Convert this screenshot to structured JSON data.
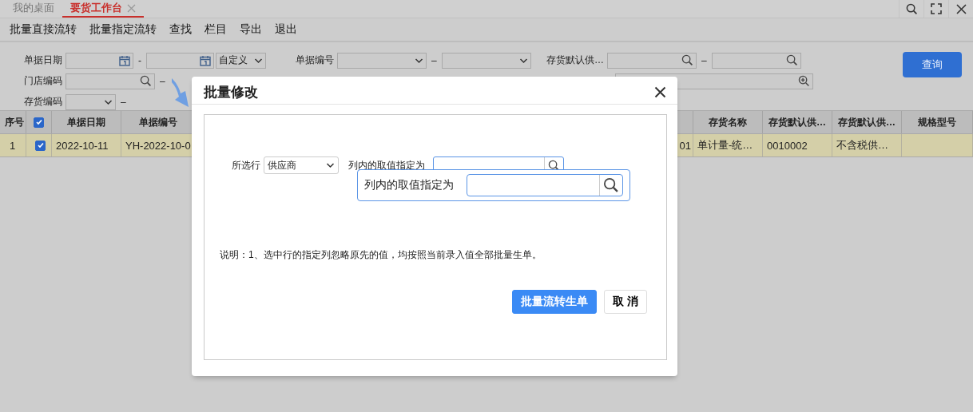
{
  "tabs": [
    {
      "label": "我的桌面",
      "selected": false,
      "closable": false
    },
    {
      "label": "要货工作台",
      "selected": true,
      "closable": true
    }
  ],
  "toolbar": [
    "批量直接流转",
    "批量指定流转",
    "查找",
    "栏目",
    "导出",
    "退出"
  ],
  "filters": [
    [
      {
        "label": "单据日期",
        "separator": "-",
        "fields": [
          {
            "kind": "date"
          },
          {
            "kind": "date"
          },
          {
            "kind": "select",
            "value": "自定义"
          }
        ]
      },
      {
        "label": "单据编号",
        "separator": "–",
        "fields": [
          {
            "kind": "select"
          },
          {
            "kind": "select"
          }
        ]
      },
      {
        "label": "存货默认供…",
        "separator": "–",
        "fields": [
          {
            "kind": "search"
          },
          {
            "kind": "search"
          }
        ]
      }
    ],
    [
      {
        "label": "门店编码",
        "separator": "–",
        "fields": [
          {
            "kind": "search"
          }
        ]
      },
      {
        "fields": [
          {
            "kind": "search_plus"
          }
        ]
      }
    ],
    [
      {
        "label": "存货编码",
        "separator": "–",
        "fields": [
          {
            "kind": "select"
          }
        ]
      }
    ]
  ],
  "query_button": "查询",
  "table": {
    "columns": [
      {
        "label": "序号",
        "kind": "text"
      },
      {
        "kind": "check",
        "checked": true
      },
      {
        "label": "单据日期",
        "kind": "text"
      },
      {
        "label": "单据编号",
        "kind": "text"
      },
      {
        "kind": "text"
      },
      {
        "label": "存货名称",
        "kind": "text"
      },
      {
        "label": "存货默认供…",
        "kind": "text"
      },
      {
        "label": "存货默认供…",
        "kind": "text"
      },
      {
        "label": "规格型号",
        "kind": "text"
      }
    ],
    "rows": [
      {
        "selected": true,
        "cells": [
          {
            "text": "1"
          },
          {
            "checked": true
          },
          {
            "text": "2022-10-11"
          },
          {
            "text": "YH-2022-10-0"
          },
          {
            "text": "01"
          },
          {
            "text": "单计量-统…"
          },
          {
            "text": "0010002"
          },
          {
            "text": "不含税供…"
          }
        ]
      }
    ]
  },
  "dialog": {
    "title": "批量修改",
    "row_label": "所选行",
    "row_select": "供应商",
    "value_label": "列内的取值指定为",
    "callout_label": "列内的取值指定为",
    "note": "说明：1、选中行的指定列忽略原先的值，均按照当前录入值全部批量生单。",
    "buttons": [
      {
        "label": "批量流转生单",
        "kind": "primary"
      },
      {
        "label": "取 消",
        "kind": "default"
      }
    ]
  }
}
